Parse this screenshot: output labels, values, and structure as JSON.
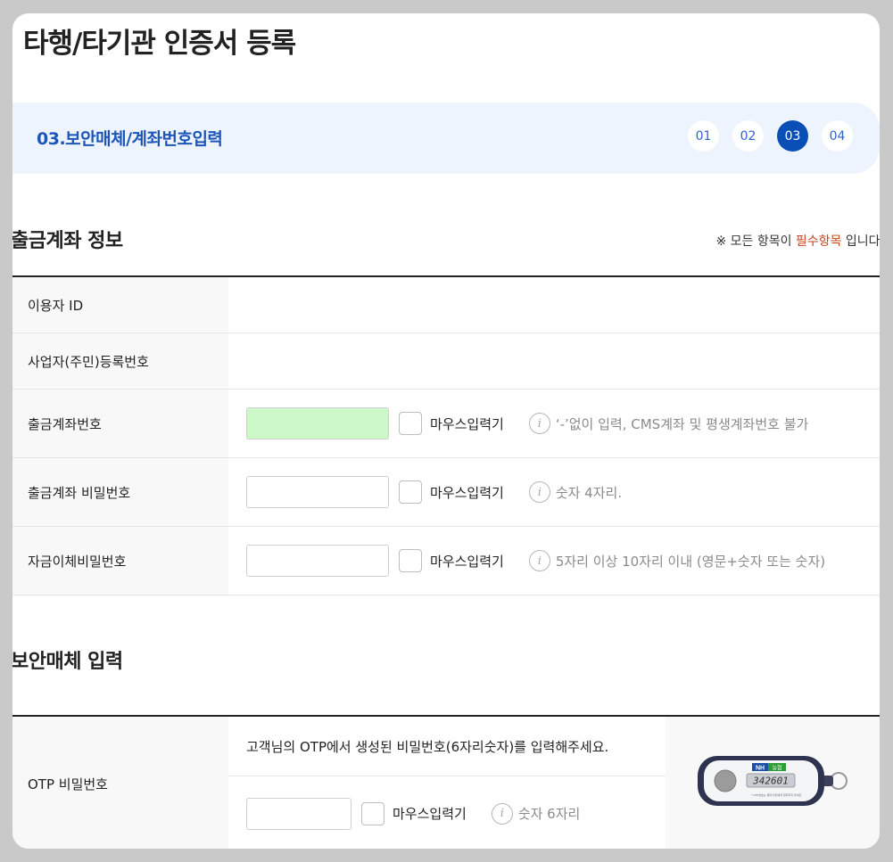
{
  "page": {
    "title": "타행/타기관 인증서 등록"
  },
  "stepper": {
    "current_title": "03.보안매체/계좌번호입력",
    "steps": [
      "01",
      "02",
      "03",
      "04"
    ],
    "active_step": "03"
  },
  "account_section": {
    "title": "출금계좌 정보",
    "notice_prefix": "※ 모든 항목이 ",
    "notice_required": "필수항목",
    "notice_suffix": " 입니다.",
    "rows": {
      "user_id": {
        "label": "이용자 ID"
      },
      "biz_reg_no": {
        "label": "사업자(주민)등록번호"
      },
      "account_no": {
        "label": "출금계좌번호",
        "value": "",
        "mouse_input_label": "마우스입력기",
        "hint": "‘-’없이 입력, CMS계좌 및 평생계좌번호 불가"
      },
      "account_pw": {
        "label": "출금계좌 비밀번호",
        "value": "",
        "mouse_input_label": "마우스입력기",
        "hint": "숫자 4자리."
      },
      "transfer_pw": {
        "label": "자금이체비밀번호",
        "value": "",
        "mouse_input_label": "마우스입력기",
        "hint": "5자리 이상 10자리 이내 (영문+숫자 또는 숫자)"
      }
    }
  },
  "security_section": {
    "title": "보안매체 입력",
    "otp": {
      "label": "OTP 비밀번호",
      "description": "고객님의 OTP에서 생성된 비밀번호(6자리숫자)를 입력해주세요.",
      "value": "",
      "mouse_input_label": "마우스입력기",
      "hint": "숫자 6자리",
      "device_brand": "NH",
      "device_brand_sub": "농협",
      "device_display": "342601",
      "device_caption": "* OTP번호는 절대 타인에게 알려주지 마세요"
    }
  },
  "colors": {
    "accent": "#0a4fb5",
    "step_title": "#1d56b8",
    "required": "#c9421f",
    "active_input": "#cdf9c9"
  },
  "icons": {
    "info": "info-icon"
  }
}
